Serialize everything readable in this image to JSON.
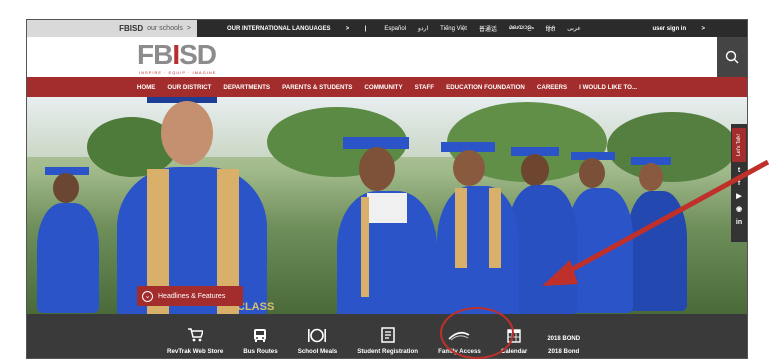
{
  "topbar": {
    "brand": "FBISD",
    "schools": "our schools",
    "chevron": ">",
    "intl_languages": "OUR INTERNATIONAL LANGUAGES",
    "separator": "|",
    "languages": [
      "Español",
      "اردو",
      "Tiếng Việt",
      "普通话",
      "മലയാളം",
      "हिंदी",
      "عربى"
    ],
    "sign_in": "user sign in"
  },
  "logo": {
    "text_a": "FB",
    "text_b": "I",
    "text_c": "SD",
    "tagline": "INSPIRE · EQUIP · IMAGINE"
  },
  "nav": {
    "items": [
      "HOME",
      "OUR DISTRICT",
      "DEPARTMENTS",
      "PARENTS & STUDENTS",
      "COMMUNITY",
      "STAFF",
      "EDUCATION FOUNDATION",
      "CAREERS",
      "I WOULD LIKE TO..."
    ]
  },
  "hero": {
    "headlines_label": "Headlines & Features",
    "sign_text": "CLASS"
  },
  "social": {
    "lets_talk": "Let's Talk!",
    "icons": [
      "twitter-icon",
      "facebook-icon",
      "youtube-icon",
      "instagram-icon",
      "linkedin-icon"
    ]
  },
  "quick_links": {
    "items": [
      {
        "label": "RevTrak Web Store",
        "icon": "cart-icon"
      },
      {
        "label": "Bus Routes",
        "icon": "bus-icon"
      },
      {
        "label": "School Meals",
        "icon": "meals-icon"
      },
      {
        "label": "Student Registration",
        "icon": "registration-icon"
      },
      {
        "label": "Family Access",
        "icon": "family-access-icon"
      },
      {
        "label": "Calendar",
        "icon": "calendar-icon"
      },
      {
        "label": "2018 Bond",
        "icon": "bond-icon",
        "top_text": "2018 BOND"
      }
    ]
  },
  "colors": {
    "brand_red": "#a32c2c",
    "dark_bar": "#2b2b2b",
    "annotation": "#c0302a"
  }
}
